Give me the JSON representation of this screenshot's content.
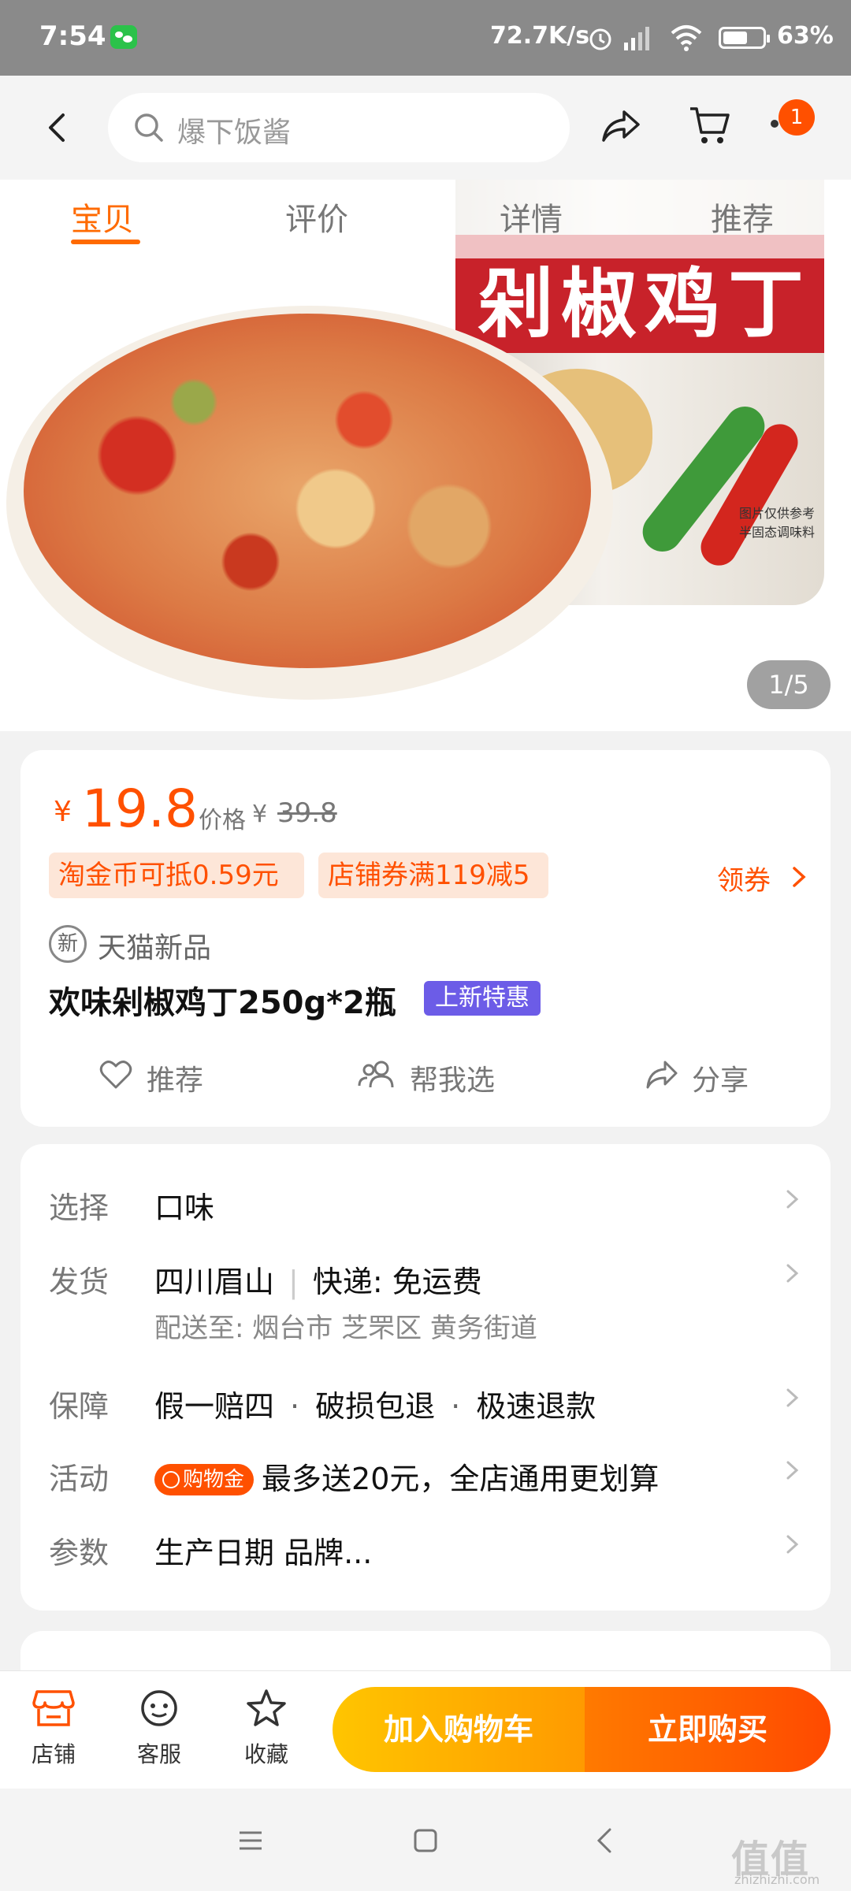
{
  "status_bar": {
    "time": "7:54",
    "network_speed": "72.7K/s",
    "battery": "63%",
    "battery_level": 0.63
  },
  "header": {
    "search_placeholder": "爆下饭酱",
    "cart_badge": "1"
  },
  "gallery": {
    "tabs": [
      "宝贝",
      "评价",
      "详情",
      "推荐"
    ],
    "active_tab": 0,
    "counter": "1/5",
    "jar_label": "剁椒鸡丁",
    "jar_fine_print": [
      "图片仅供参考",
      "半固态调味料"
    ]
  },
  "product": {
    "currency": "¥",
    "price": "19.8",
    "original_label": "价格",
    "original_currency": "¥",
    "original_price": "39.8",
    "tags": [
      "淘金币可抵0.59元",
      "店铺券满119减5"
    ],
    "coupon_label": "领券",
    "new_icon_text": "新",
    "new_label": "天猫新品",
    "title": "欢味剁椒鸡丁250g*2瓶",
    "title_badge": "上新特惠",
    "actions": [
      "推荐",
      "帮我选",
      "分享"
    ]
  },
  "info": {
    "rows": [
      {
        "key": "选择",
        "value": "口味"
      },
      {
        "key": "发货",
        "origin": "四川眉山",
        "shipping": "快递: 免运费",
        "sub": "配送至: 烟台市 芝罘区 黄务街道"
      },
      {
        "key": "保障",
        "items": [
          "假一赔四",
          "破损包退",
          "极速退款"
        ]
      },
      {
        "key": "活动",
        "badge": "购物金",
        "value": "最多送20元，全店通用更划算"
      },
      {
        "key": "参数",
        "value": "生产日期 品牌..."
      }
    ]
  },
  "bottom_bar": {
    "items": [
      "店铺",
      "客服",
      "收藏"
    ],
    "add_to_cart": "加入购物车",
    "buy_now": "立即购买"
  },
  "watermark": {
    "text": "值值值",
    "url": "zhizhizhi.com"
  },
  "colors": {
    "accent": "#ff5000",
    "tab_active": "#ff6a00",
    "badge_purple": "#6c5ce7",
    "cart_button": "#ffb300",
    "buy_button": "#ff5a00"
  }
}
